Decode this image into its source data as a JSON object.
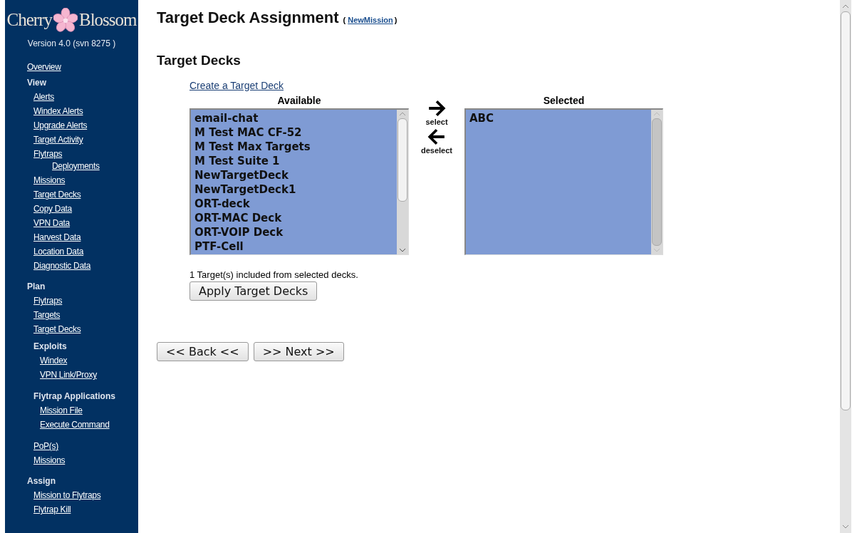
{
  "sidebar": {
    "logo": {
      "left": "Cherry",
      "right": "Blossom"
    },
    "version": "Version 4.0 (svn 8275 )",
    "items": [
      {
        "kind": "link",
        "label": "Overview"
      },
      {
        "kind": "heading",
        "label": "View",
        "children": [
          {
            "kind": "link",
            "label": "Alerts"
          },
          {
            "kind": "link",
            "label": "Windex Alerts"
          },
          {
            "kind": "link",
            "label": "Upgrade Alerts"
          },
          {
            "kind": "link",
            "label": "Target Activity"
          },
          {
            "kind": "link",
            "label": "Flytraps",
            "children": [
              {
                "kind": "link",
                "label": "Deployments"
              }
            ]
          },
          {
            "kind": "link",
            "label": "Missions"
          },
          {
            "kind": "link",
            "label": "Target Decks"
          },
          {
            "kind": "link",
            "label": "Copy Data"
          },
          {
            "kind": "link",
            "label": "VPN Data"
          },
          {
            "kind": "link",
            "label": "Harvest Data"
          },
          {
            "kind": "link",
            "label": "Location Data"
          },
          {
            "kind": "link",
            "label": "Diagnostic Data"
          }
        ]
      },
      {
        "kind": "heading",
        "label": "Plan",
        "children": [
          {
            "kind": "link",
            "label": "Flytraps"
          },
          {
            "kind": "link",
            "label": "Targets"
          },
          {
            "kind": "link",
            "label": "Target Decks"
          },
          {
            "kind": "heading",
            "label": "Exploits",
            "children": [
              {
                "kind": "link",
                "label": "Windex"
              },
              {
                "kind": "link",
                "label": "VPN Link/Proxy"
              }
            ]
          },
          {
            "kind": "heading",
            "label": "Flytrap Applications",
            "children": [
              {
                "kind": "link",
                "label": "Mission File"
              },
              {
                "kind": "link",
                "label": "Execute Command"
              }
            ]
          },
          {
            "kind": "link",
            "label": "PoP(s)"
          },
          {
            "kind": "link",
            "label": "Missions"
          }
        ]
      },
      {
        "kind": "heading",
        "label": "Assign",
        "children": [
          {
            "kind": "link",
            "label": "Mission to Flytraps"
          },
          {
            "kind": "link",
            "label": "Flytrap Kill"
          }
        ]
      }
    ]
  },
  "title": "Target Deck Assignment",
  "mission_link": "NewMission",
  "open_paren": "(",
  "close_paren": ")",
  "section_title": "Target Decks",
  "create_link": "Create a Target Deck",
  "available": {
    "label": "Available",
    "items": [
      "email-chat",
      "M Test MAC CF-52",
      "M Test Max Targets",
      "M Test Suite 1",
      "NewTargetDeck",
      "NewTargetDeck1",
      "ORT-deck",
      "ORT-MAC Deck",
      "ORT-VOIP Deck",
      "PTF-Cell"
    ]
  },
  "select_label": "select",
  "deselect_label": "deselect",
  "selected": {
    "label": "Selected",
    "items": [
      "ABC"
    ]
  },
  "summary": "1 Target(s) included from selected decks.",
  "apply_button": "Apply Target Decks",
  "back_button": "<< Back <<",
  "next_button": ">> Next >>"
}
